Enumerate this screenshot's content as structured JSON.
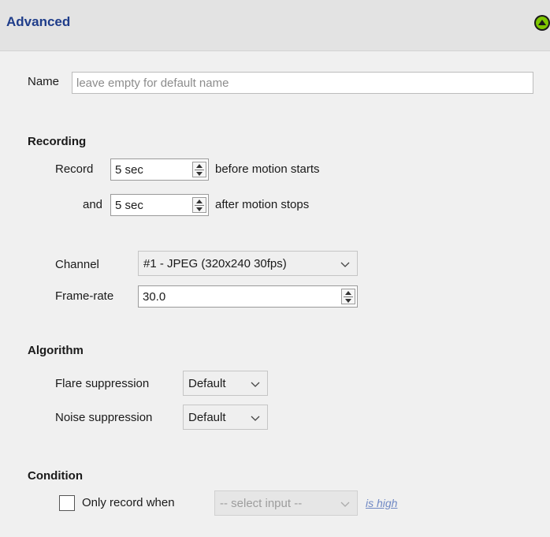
{
  "header": {
    "title": "Advanced",
    "collapse_icon": "collapse-up-icon",
    "accent": "#1f3d8a",
    "icon_color": "#7ec700"
  },
  "name": {
    "label": "Name",
    "placeholder": "leave empty for default name",
    "value": ""
  },
  "recording": {
    "heading": "Recording",
    "pre": {
      "label": "Record",
      "value": "5 sec",
      "suffix": "before motion starts"
    },
    "post": {
      "label": "and",
      "value": "5 sec",
      "suffix": "after motion stops"
    },
    "channel": {
      "label": "Channel",
      "value": "#1 - JPEG (320x240 30fps)"
    },
    "framerate": {
      "label": "Frame-rate",
      "value": "30.0"
    }
  },
  "algorithm": {
    "heading": "Algorithm",
    "flare": {
      "label": "Flare suppression",
      "value": "Default"
    },
    "noise": {
      "label": "Noise suppression",
      "value": "Default"
    }
  },
  "condition": {
    "heading": "Condition",
    "checkbox_label": "Only record when",
    "checked": false,
    "input_select": "-- select input --",
    "state_link": "is high"
  }
}
